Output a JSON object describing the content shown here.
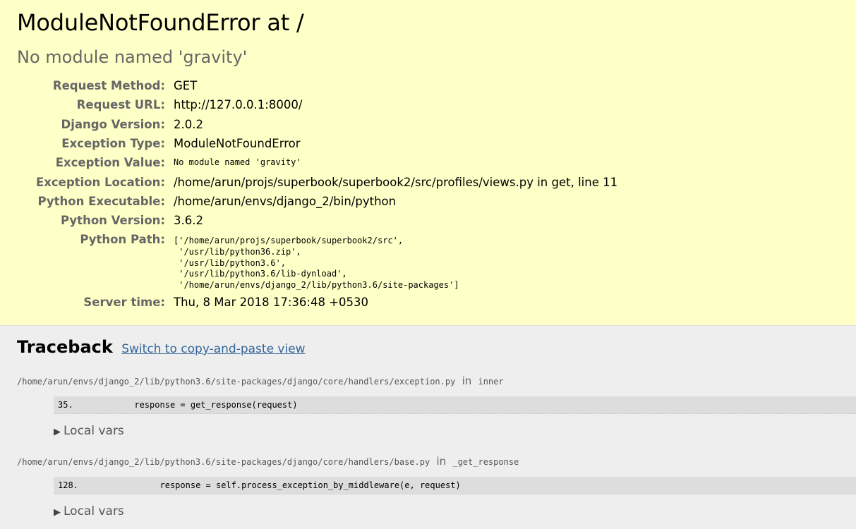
{
  "summary": {
    "title": "ModuleNotFoundError at /",
    "subtitle": "No module named 'gravity'",
    "rows": [
      {
        "label": "Request Method:",
        "value": "GET"
      },
      {
        "label": "Request URL:",
        "value": "http://127.0.0.1:8000/"
      },
      {
        "label": "Django Version:",
        "value": "2.0.2"
      },
      {
        "label": "Exception Type:",
        "value": "ModuleNotFoundError"
      },
      {
        "label": "Exception Value:",
        "value": "No module named 'gravity'"
      },
      {
        "label": "Exception Location:",
        "value": "/home/arun/projs/superbook/superbook2/src/profiles/views.py in get, line 11"
      },
      {
        "label": "Python Executable:",
        "value": "/home/arun/envs/django_2/bin/python"
      },
      {
        "label": "Python Version:",
        "value": "3.6.2"
      },
      {
        "label": "Python Path:",
        "value": "['/home/arun/projs/superbook/superbook2/src',\n '/usr/lib/python36.zip',\n '/usr/lib/python3.6',\n '/usr/lib/python3.6/lib-dynload',\n '/home/arun/envs/django_2/lib/python3.6/site-packages']"
      },
      {
        "label": "Server time:",
        "value": "Thu, 8 Mar 2018 17:36:48 +0530"
      }
    ]
  },
  "traceback": {
    "heading": "Traceback",
    "switch_link": "Switch to copy-and-paste view",
    "frames": [
      {
        "file": "/home/arun/envs/django_2/lib/python3.6/site-packages/django/core/handlers/exception.py",
        "in": "in",
        "func": "inner",
        "line_no": "35.",
        "code": "            response = get_response(request)",
        "local_vars": "Local vars"
      },
      {
        "file": "/home/arun/envs/django_2/lib/python3.6/site-packages/django/core/handlers/base.py",
        "in": "in",
        "func": "_get_response",
        "line_no": "128.",
        "code": "                response = self.process_exception_by_middleware(e, request)",
        "local_vars": "Local vars"
      }
    ]
  }
}
